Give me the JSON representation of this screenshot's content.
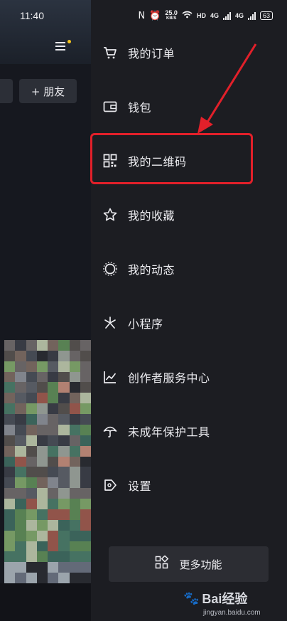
{
  "status_bar": {
    "time": "11:40",
    "net_speed": "25.0",
    "net_unit": "KB/S",
    "hd_label": "HD",
    "net1": "4G",
    "net2": "4G",
    "battery": "63"
  },
  "left_panel": {
    "add_friend_label": "+ 朋友"
  },
  "menu": {
    "items": [
      {
        "label": "我的订单",
        "icon": "cart-icon"
      },
      {
        "label": "钱包",
        "icon": "wallet-icon"
      },
      {
        "label": "我的二维码",
        "icon": "qr-code-icon"
      },
      {
        "label": "我的收藏",
        "icon": "star-icon"
      },
      {
        "label": "我的动态",
        "icon": "activity-icon"
      },
      {
        "label": "小程序",
        "icon": "mini-program-icon"
      },
      {
        "label": "创作者服务中心",
        "icon": "creator-chart-icon"
      },
      {
        "label": "未成年保护工具",
        "icon": "umbrella-icon"
      },
      {
        "label": "设置",
        "icon": "settings-tag-icon"
      }
    ],
    "more_label": "更多功能"
  },
  "annotation": {
    "highlight_color": "#e2202a"
  },
  "watermark": {
    "brand": "Bai经验",
    "url": "jingyan.baidu.com"
  }
}
